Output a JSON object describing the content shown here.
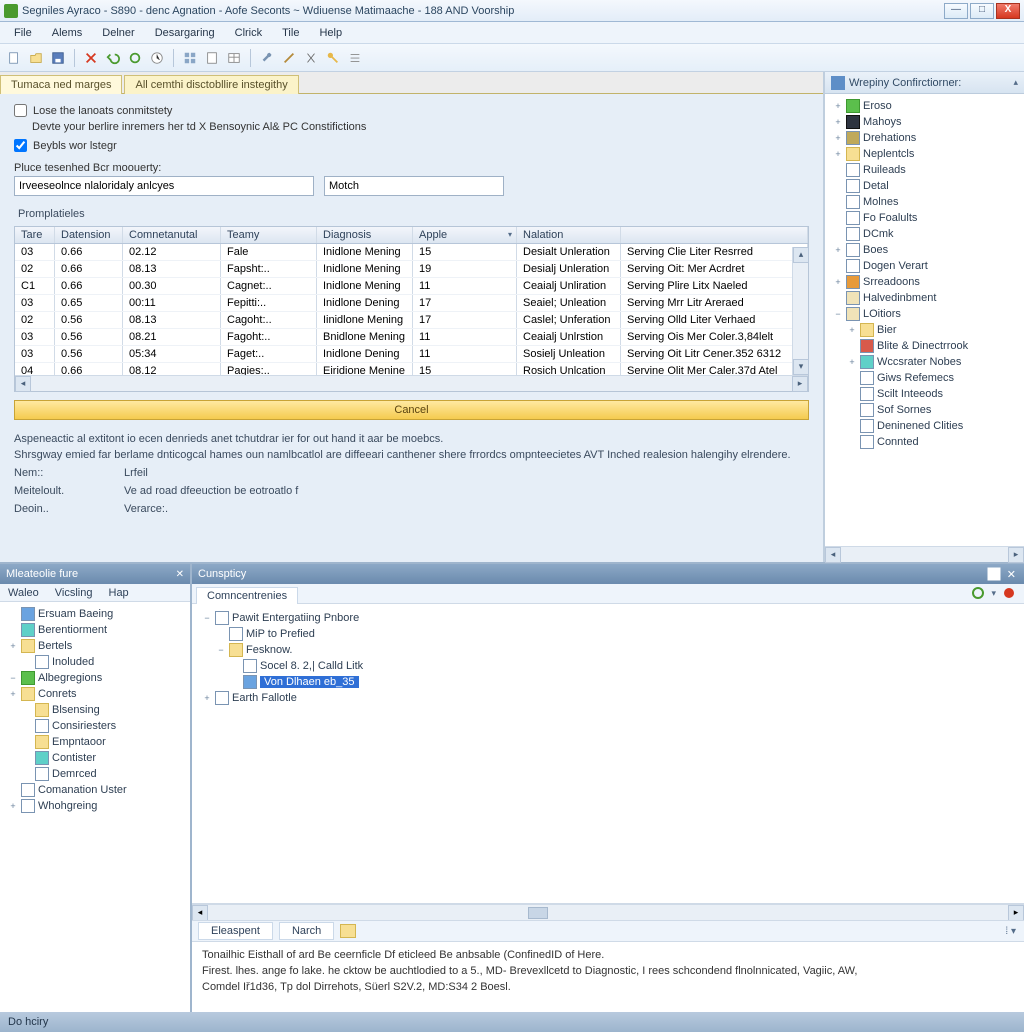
{
  "title": "Segniles Ayraco - S890 - denc Agnation - Aofe Seconts ~ Wdiuense Matimaache - 188 AND Voorship",
  "win": {
    "min": "—",
    "max": "□",
    "close": "X"
  },
  "menu": [
    "File",
    "Alems",
    "Delner",
    "Desargaring",
    "Clrick",
    "Tile",
    "Help"
  ],
  "tabs": [
    "Tumaca ned marges",
    "All cemthi disctobllire instegithy"
  ],
  "checks": {
    "c1": "Lose the lanoats conmitstety",
    "c2_line": "Devte your berlire inremers her td X Bensoynic Al& PC Constifictions",
    "c3": "Beybls wor lstegr"
  },
  "fieldLabel": "Pluce tesenhed Bcr moouerty:",
  "input1": "Irveeseolnce nlaloridaly anlcyes",
  "input2": "Motch",
  "tableCaption": "Promplatieles",
  "cols": [
    "Tare",
    "Datension",
    "Comnetanutal",
    "Teamy",
    "Diagnosis",
    "Apple",
    "Nalation",
    ""
  ],
  "rows": [
    [
      "03",
      "0.66",
      "02.12",
      "Fale",
      "Inidlone Mening",
      "15",
      "Desialt Unleration",
      "Serving Clie Liter Resrred"
    ],
    [
      "02",
      "0.66",
      "08.13",
      "Fapsht:..",
      "Inidlone Mening",
      "19",
      "Desialj Unleration",
      "Serving Oit: Mer Acrdret"
    ],
    [
      "C1",
      "0.66",
      "00.30",
      "Cagnet:..",
      "Inidlone Mening",
      "11",
      "Ceaialj Unliration",
      "Serving Plire Litx Naeled"
    ],
    [
      "03",
      "0.65",
      "00:11",
      "Fepitti:..",
      "Inidlone Dening",
      "17",
      "Seaiel; Unleation",
      "Serving Mrr Litr Areraed"
    ],
    [
      "02",
      "0.56",
      "08.13",
      "Cagoht:..",
      "Iinidlone Mening",
      "17",
      "Caslel; Unferation",
      "Serving Olld Liter Verhaed"
    ],
    [
      "03",
      "0.56",
      "08.21",
      "Fagoht:..",
      "Bnidlone Mening",
      "11",
      "Ceaialj Unlrstion",
      "Serving Ois Mer Coler.3,84lelt"
    ],
    [
      "03",
      "0.56",
      "05:34",
      "Faget:..",
      "Inidlone Dening",
      "11",
      "Sosielj Unleation",
      "Serving Oit Litr Cener.352 6312"
    ],
    [
      "04",
      "0.66",
      "08.12",
      "Pagies:..",
      "Eiridione Menine",
      "15",
      "Rosich Unlcation",
      "Servine Olit Mer Caler.37d Atel"
    ]
  ],
  "cancel": "Cancel",
  "para1": "Aspeneactic al extitont io ecen denrieds anet tchutdrar ier for out hand it aar be moebcs.",
  "para2": "Shrsgway emied far berlame dnticogcal hames oun namlbcatlol are diffeeari canthener shere frrordcs ompnteecietes AVT Inched realesion halengihy elrendere.",
  "kv": [
    [
      "Nem::",
      "Lrfeil"
    ],
    [
      "Meiteloult.",
      "Ve ad road dfeeuction be eotroatlo f"
    ],
    [
      "Deoin..",
      "Verarce:."
    ]
  ],
  "side": {
    "title": "Wrepiny Confirctiorner:",
    "items": [
      {
        "l": 1,
        "t": "+",
        "i": "green",
        "n": "Eroso"
      },
      {
        "l": 1,
        "t": "+",
        "i": "shield",
        "n": "Mahoys"
      },
      {
        "l": 1,
        "t": "+",
        "i": "gear",
        "n": "Drehations"
      },
      {
        "l": 1,
        "t": "+",
        "i": "folder",
        "n": "Neplentcls"
      },
      {
        "l": 1,
        "t": "",
        "i": "page",
        "n": "Ruileads"
      },
      {
        "l": 1,
        "t": "",
        "i": "page",
        "n": "Detal"
      },
      {
        "l": 1,
        "t": "",
        "i": "page",
        "n": "Molnes"
      },
      {
        "l": 1,
        "t": "",
        "i": "page",
        "n": "Fo Foalults"
      },
      {
        "l": 1,
        "t": "",
        "i": "page",
        "n": "DCmk"
      },
      {
        "l": 1,
        "t": "+",
        "i": "page",
        "n": "Boes"
      },
      {
        "l": 1,
        "t": "",
        "i": "page",
        "n": "Dogen Verart"
      },
      {
        "l": 1,
        "t": "+",
        "i": "orange",
        "n": "Srreadoons"
      },
      {
        "l": 1,
        "t": "",
        "i": "beige",
        "n": "Halvedinbment"
      },
      {
        "l": 1,
        "t": "−",
        "i": "beige",
        "n": "LOitiors"
      },
      {
        "l": 2,
        "t": "+",
        "i": "folder",
        "n": "Bier"
      },
      {
        "l": 2,
        "t": "",
        "i": "red",
        "n": "Blite & Dinectrrook"
      },
      {
        "l": 2,
        "t": "+",
        "i": "teal",
        "n": "Wccsrater Nobes"
      },
      {
        "l": 2,
        "t": "",
        "i": "page",
        "n": "Giws Refemecs"
      },
      {
        "l": 2,
        "t": "",
        "i": "page",
        "n": "Scilt Inteeods"
      },
      {
        "l": 2,
        "t": "",
        "i": "page",
        "n": "Sof Sornes"
      },
      {
        "l": 2,
        "t": "",
        "i": "page",
        "n": "Deninened Clities"
      },
      {
        "l": 2,
        "t": "",
        "i": "page",
        "n": "Connted"
      }
    ]
  },
  "left": {
    "title": "Mleateolie fure",
    "menu": [
      "Waleo",
      "Vicsling",
      "Hap"
    ],
    "tree": [
      {
        "l": 1,
        "t": "",
        "i": "blue",
        "n": "Ersuam Baeing"
      },
      {
        "l": 1,
        "t": "",
        "i": "teal",
        "n": "Berentiorment"
      },
      {
        "l": 1,
        "t": "+",
        "i": "folder",
        "n": "Bertels"
      },
      {
        "l": 2,
        "t": "",
        "i": "page",
        "n": "Inoluded"
      },
      {
        "l": 1,
        "t": "−",
        "i": "green",
        "n": "Albegregions"
      },
      {
        "l": 1,
        "t": "+",
        "i": "folder",
        "n": "Conrets"
      },
      {
        "l": 2,
        "t": "",
        "i": "folder",
        "n": "Blsensing"
      },
      {
        "l": 2,
        "t": "",
        "i": "page",
        "n": "Consiriesters"
      },
      {
        "l": 2,
        "t": "",
        "i": "folder",
        "n": "Empntaoor"
      },
      {
        "l": 2,
        "t": "",
        "i": "teal",
        "n": "Contister"
      },
      {
        "l": 2,
        "t": "",
        "i": "page",
        "n": "Demrced"
      },
      {
        "l": 1,
        "t": "",
        "i": "page",
        "n": "Comanation Uster"
      },
      {
        "l": 1,
        "t": "+",
        "i": "page",
        "n": "Whohgreing"
      }
    ]
  },
  "right": {
    "title": "Cunspticy",
    "tab": "Comncentrenies",
    "tree": [
      {
        "l": 1,
        "t": "−",
        "i": "page",
        "n": "Pawit Entergatiing Pnbore"
      },
      {
        "l": 2,
        "t": "",
        "i": "page",
        "n": "MiP to Prefied"
      },
      {
        "l": 2,
        "t": "−",
        "i": "folder",
        "n": "Fesknow."
      },
      {
        "l": 3,
        "t": "",
        "i": "page",
        "n": "Socel 8. 2,| Calld Litk"
      },
      {
        "l": 3,
        "t": "",
        "i": "blue",
        "n": "Von Dlhaen eb_35",
        "sel": true
      },
      {
        "l": 1,
        "t": "+",
        "i": "page",
        "n": "Earth Fallotle"
      }
    ],
    "btabs": [
      "Eleaspent",
      "Narch"
    ],
    "detail1": "Tonailhic Eisthall of ard Be ceernficle Df eticleed Be anbsable (ConfinedID of Here.",
    "detail2": "Firest. lhes. ange fo lake. he cktow be auchtlodied to a 5., MD- Brevexllcetd to Diagnostic, I rees schcondend flnolnnicated, Vagiic, AW,",
    "detail3": "Comdel Iř1d36, Tp dol Dirrehots, Süerl S2V.2, MD:S34 2 Boesl."
  },
  "status": "Do hciry"
}
